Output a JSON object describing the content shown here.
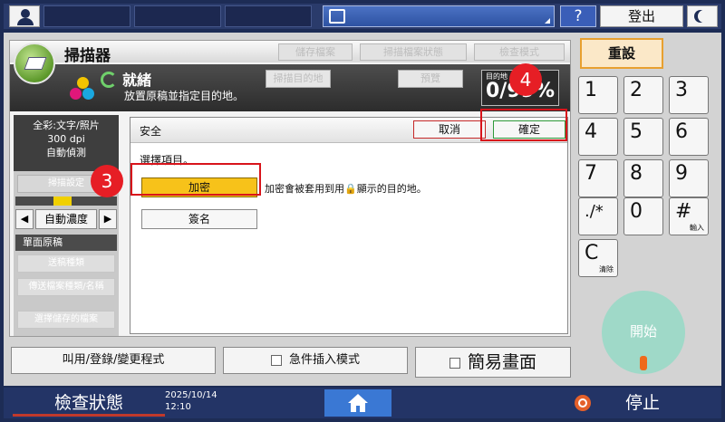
{
  "topbar": {
    "logout_label": "登出",
    "help_label": "?"
  },
  "app": {
    "title": "掃描器",
    "header_buttons": [
      "儲存檔案",
      "掃描檔案狀態",
      "檢查模式"
    ],
    "status_title": "就緒",
    "status_sub": "放置原稿並指定目的地。",
    "strip_buttons": [
      "掃描目的地",
      "預覽"
    ],
    "dest_label": "目的地",
    "dest_count": "0/99%"
  },
  "left": {
    "color_info": [
      "全彩:文字/照片",
      "300 dpi",
      "自動偵測"
    ],
    "button1": "掃描設定",
    "density_label": "自動濃度",
    "single_original": "單面原稿",
    "disabled_buttons": [
      "送稿種類",
      "傳送檔案種類/名稱",
      "選擇儲存的檔案"
    ]
  },
  "dialog": {
    "title": "安全",
    "cancel": "取消",
    "ok": "確定",
    "select_text": "選擇項目。",
    "encrypt": "加密",
    "encrypt_desc": "加密會被套用到用🔒顯示的目的地。",
    "sign": "簽名"
  },
  "annotations": {
    "badge3": "3",
    "badge4": "4"
  },
  "bottom": {
    "recall": "叫用/登錄/變更程式",
    "interrupt": "急件插入模式",
    "simple": "簡易畫面"
  },
  "keypad": {
    "reset": "重設",
    "keys": [
      "1",
      "2",
      "3",
      "4",
      "5",
      "6",
      "7",
      "8",
      "9",
      "./*",
      "0",
      "#",
      "C"
    ],
    "hash_sub": "輸入",
    "clear_sub": "清除",
    "start": "開始"
  },
  "footer": {
    "check_status": "檢查狀態",
    "date": "2025/10/14",
    "time": "12:10",
    "stop": "停止"
  },
  "colors": {
    "accent_red": "#d8141b",
    "encrypt_yellow": "#f7c21a",
    "ok_green": "#2f9a3a"
  }
}
